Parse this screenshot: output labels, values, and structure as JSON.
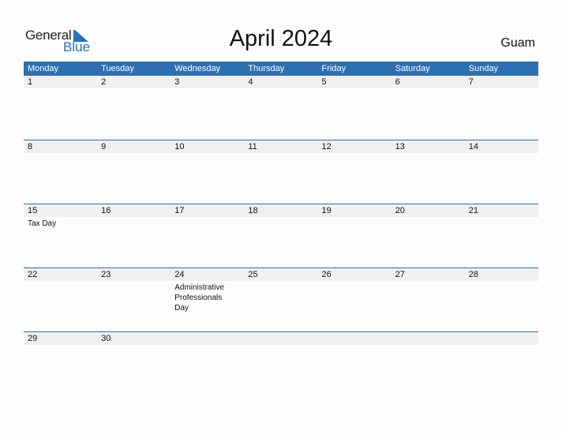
{
  "logo": {
    "general": "General",
    "blue": "Blue"
  },
  "title": "April 2024",
  "country": "Guam",
  "colors": {
    "accent": "#2e6fb1",
    "row_bg": "#f0f0f0"
  },
  "weekdays": [
    "Monday",
    "Tuesday",
    "Wednesday",
    "Thursday",
    "Friday",
    "Saturday",
    "Sunday"
  ],
  "weeks": [
    {
      "days": [
        "1",
        "2",
        "3",
        "4",
        "5",
        "6",
        "7"
      ],
      "events": [
        "",
        "",
        "",
        "",
        "",
        "",
        ""
      ]
    },
    {
      "days": [
        "8",
        "9",
        "10",
        "11",
        "12",
        "13",
        "14"
      ],
      "events": [
        "",
        "",
        "",
        "",
        "",
        "",
        ""
      ]
    },
    {
      "days": [
        "15",
        "16",
        "17",
        "18",
        "19",
        "20",
        "21"
      ],
      "events": [
        "Tax Day",
        "",
        "",
        "",
        "",
        "",
        ""
      ]
    },
    {
      "days": [
        "22",
        "23",
        "24",
        "25",
        "26",
        "27",
        "28"
      ],
      "events": [
        "",
        "",
        "Administrative Professionals Day",
        "",
        "",
        "",
        ""
      ]
    },
    {
      "days": [
        "29",
        "30",
        "",
        "",
        "",
        "",
        ""
      ],
      "events": [
        "",
        "",
        "",
        "",
        "",
        "",
        ""
      ]
    }
  ]
}
